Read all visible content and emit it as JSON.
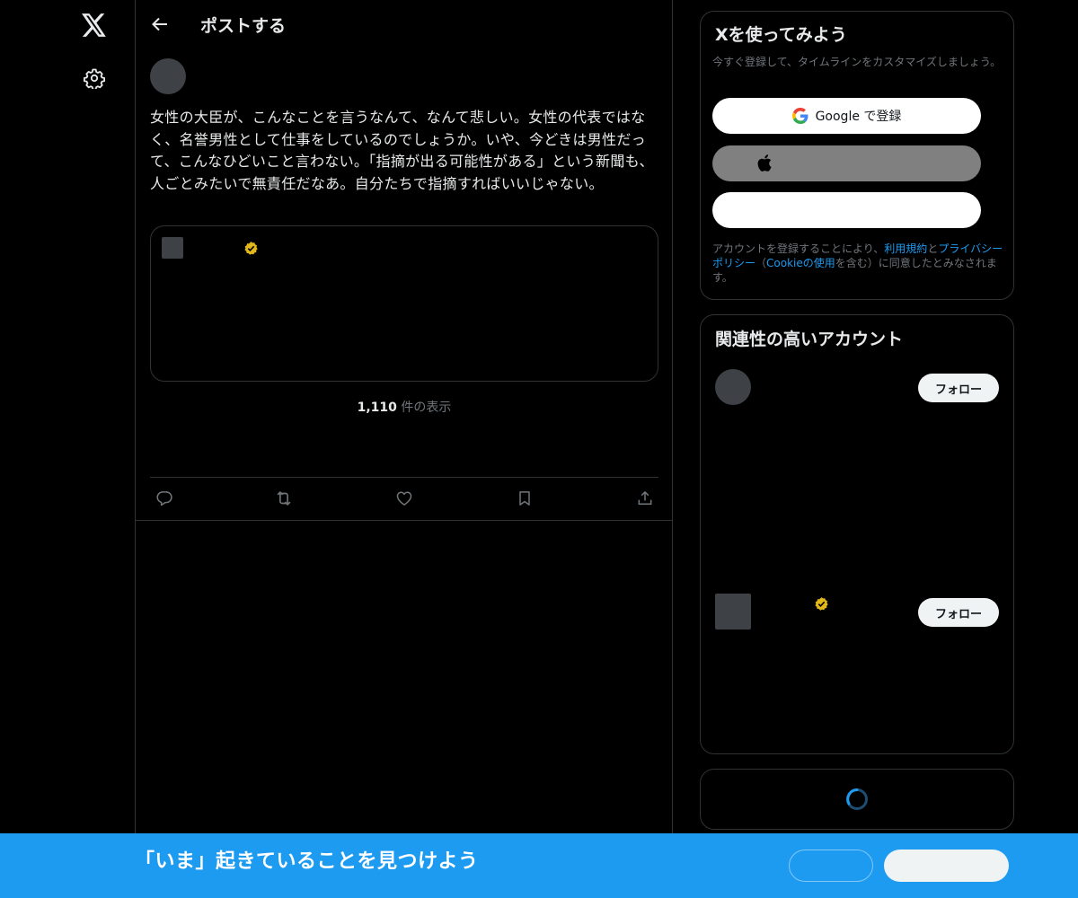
{
  "header": {
    "title": "ポストする"
  },
  "post": {
    "text": "女性の大臣が、こんなことを言うなんて、なんて悲しい。女性の代表ではなく、名誉男性として仕事をしているのでしょうか。いや、今どきは男性だって、こんなひどいこと言わない。「指摘が出る可能性がある」という新聞も、人ごとみたいで無責任だなあ。自分たちで指摘すればいいじゃない。",
    "view_count": "1,110",
    "view_label": " 件の表示"
  },
  "signup": {
    "title": "Xを使ってみよう",
    "subtitle": "今すぐ登録して、タイムラインをカスタマイズしましょう。",
    "google_label": "Google で登録",
    "terms_pre": "アカウントを登録することにより、",
    "terms_link1": "利用規約",
    "terms_mid": "と",
    "terms_link2": "プライバシーポリシー",
    "terms_mid2": "（",
    "terms_link3": "Cookieの使用",
    "terms_post": "を含む）に同意したとみなされます。"
  },
  "related": {
    "title": "関連性の高いアカウント",
    "follow_label": "フォロー"
  },
  "banner": {
    "text": "「いま」起きていることを見つけよう"
  },
  "colors": {
    "accent": "#1d9bf0",
    "verified_badge": "#e2b719",
    "background": "#000000",
    "border": "#2f3336"
  },
  "icons": [
    "x-logo-icon",
    "gear-icon",
    "back-arrow-icon",
    "verified-badge-icon",
    "reply-icon",
    "repost-icon",
    "like-icon",
    "bookmark-icon",
    "share-icon",
    "google-icon",
    "apple-icon",
    "loading-spinner-icon"
  ]
}
